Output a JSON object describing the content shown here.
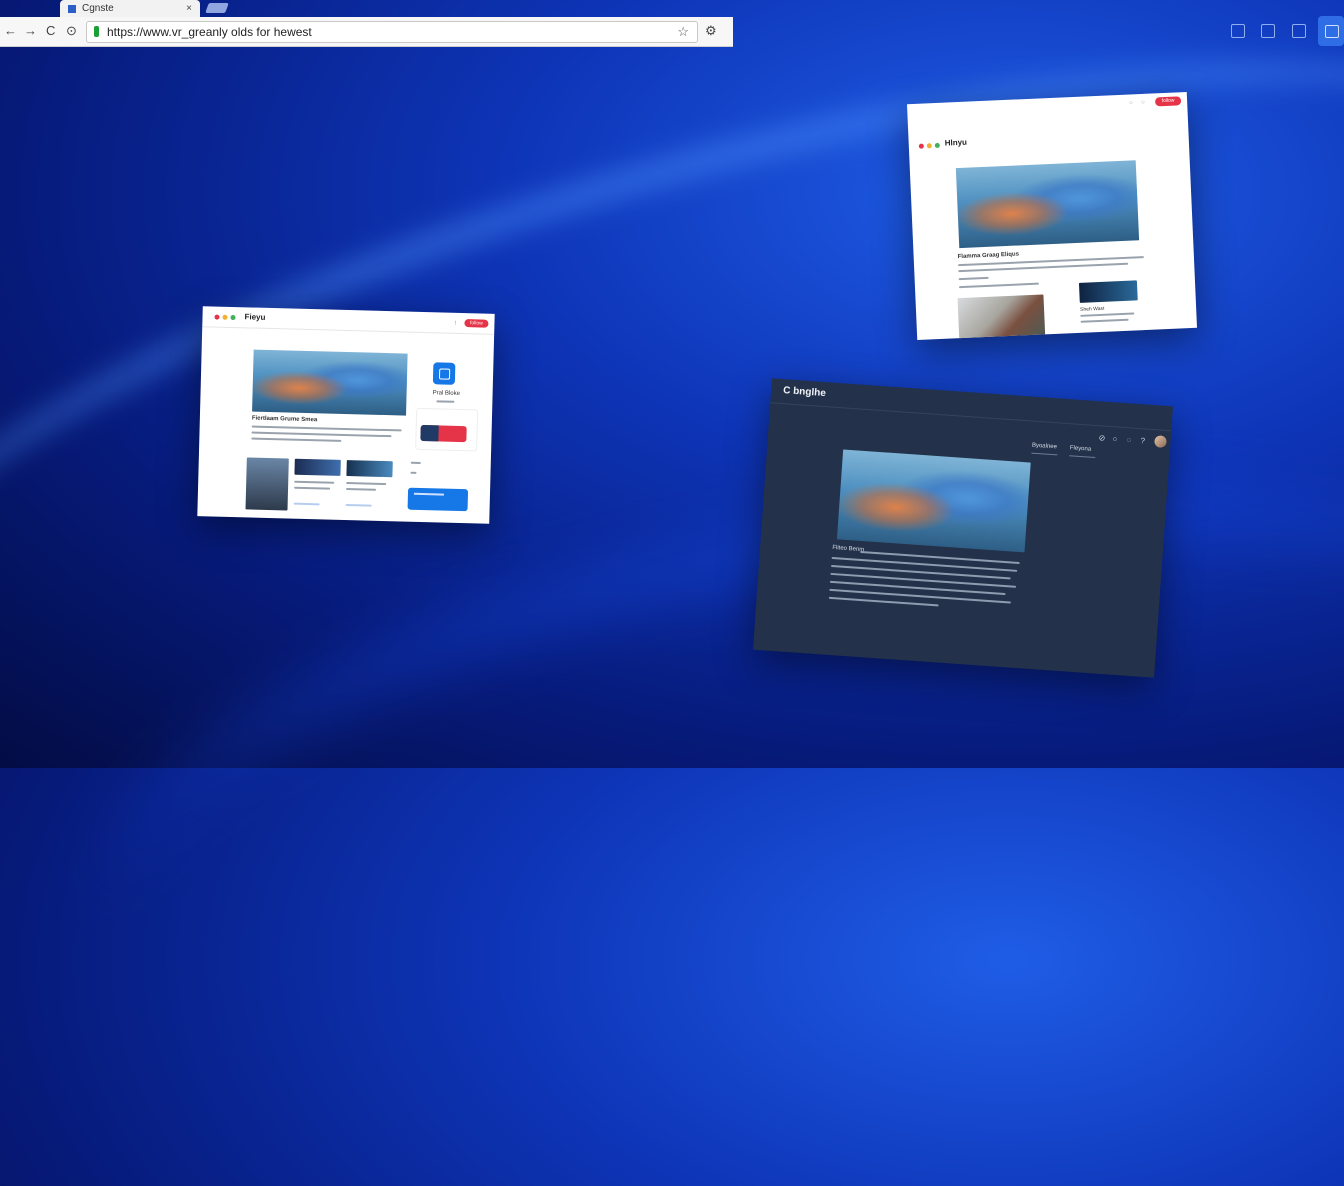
{
  "browser": {
    "tab_title": "Cgnste",
    "tab_close": "×",
    "url": "https://www.vr_greanly olds for hewest",
    "back": "←",
    "forward": "→",
    "reload": "C",
    "home": "⊙",
    "star": "☆",
    "extension": "⚙"
  },
  "windows": {
    "left": {
      "title": "Fieyu",
      "button": "follow",
      "caption": "Fiertlaam Grume Smea",
      "side_name": "Pral Bloke"
    },
    "right": {
      "title": "Hlnyu",
      "button": "follow",
      "caption": "Flamma Graag Eliqus",
      "side_caption": "Sheh Wast"
    },
    "dark": {
      "title": "C bnglhe",
      "nav_tab_1": "Byoalnee",
      "nav_tab_2": "Fleyona",
      "caption": "Fliteo Benm"
    }
  }
}
